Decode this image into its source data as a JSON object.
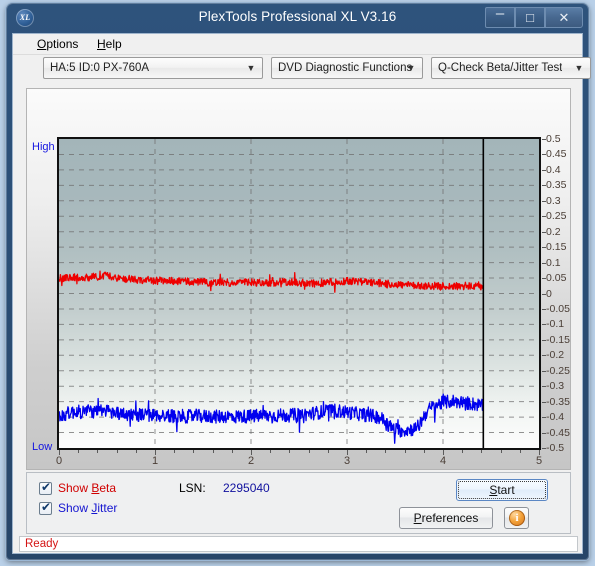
{
  "window": {
    "title": "PlexTools Professional XL V3.16",
    "icon": "xl-logo-icon",
    "minimize": "–",
    "maximize": "□",
    "close": "✕"
  },
  "menubar": {
    "items": [
      {
        "label": "Options",
        "accel": "O"
      },
      {
        "label": "Help",
        "accel": "H"
      }
    ]
  },
  "toolbar": {
    "drive_combo": {
      "value": "HA:5 ID:0  PX-760A",
      "arrow": "▼"
    },
    "function_combo": {
      "value": "DVD Diagnostic Functions",
      "arrow": "▼"
    },
    "test_combo": {
      "value": "Q-Check Beta/Jitter Test",
      "arrow": "▼"
    }
  },
  "chart_labels": {
    "high": "High",
    "low": "Low"
  },
  "controls": {
    "show_beta": {
      "label": "Show Beta",
      "accel": "B",
      "checked": true,
      "color": "#d00000",
      "tick": "✔"
    },
    "show_jitter": {
      "label": "Show Jitter",
      "accel": "J",
      "checked": true,
      "color": "#1515d0",
      "tick": "✔"
    },
    "lsn_label": "LSN:",
    "lsn_value": "2295040",
    "start_button": {
      "label": "Start",
      "accel": "S"
    },
    "preferences_button": {
      "label": "Preferences",
      "accel": "P"
    },
    "info_button": {
      "label": "i"
    }
  },
  "statusbar": {
    "text": "Ready"
  },
  "colors": {
    "beta": "#ee0000",
    "jitter": "#0000ee",
    "titlebar": "#2b4f77",
    "plot_top": "#a3b5b9",
    "plot_bottom": "#fdfdfd",
    "status_text": "#d41414",
    "marker_line": "#000000"
  },
  "chart_data": {
    "type": "line",
    "title": "Q-Check Beta/Jitter Test",
    "xlabel": "",
    "ylabel": "",
    "xlim": [
      0,
      5
    ],
    "ylim": [
      -0.5,
      0.5
    ],
    "grid": true,
    "legend_position": "bottom-left",
    "x_ticks": [
      0,
      1,
      2,
      3,
      4,
      5
    ],
    "y_ticks": [
      0.5,
      0.45,
      0.4,
      0.35,
      0.3,
      0.25,
      0.2,
      0.15,
      0.1,
      0.05,
      0,
      -0.05,
      -0.1,
      -0.15,
      -0.2,
      -0.25,
      -0.3,
      -0.35,
      -0.4,
      -0.45,
      -0.5
    ],
    "annotations": [
      {
        "type": "vline",
        "x": 4.42,
        "label": "data-end-marker"
      },
      {
        "type": "axis-text",
        "text": "High",
        "position": "top-left"
      },
      {
        "type": "axis-text",
        "text": "Low",
        "position": "bottom-left"
      }
    ],
    "series": [
      {
        "name": "Beta",
        "color": "#ee0000",
        "x_range": [
          0.0,
          4.42
        ],
        "noise_amplitude": 0.012,
        "values": [
          0.052,
          0.05,
          0.053,
          0.049,
          0.054,
          0.051,
          0.05,
          0.052,
          0.055,
          0.053,
          0.056,
          0.058,
          0.054,
          0.052,
          0.05,
          0.048,
          0.047,
          0.046,
          0.045,
          0.044,
          0.043,
          0.044,
          0.042,
          0.041,
          0.042,
          0.04,
          0.041,
          0.039,
          0.04,
          0.038,
          0.039,
          0.037,
          0.038,
          0.036,
          0.037,
          0.035,
          0.036,
          0.037,
          0.038,
          0.036,
          0.035,
          0.034,
          0.035,
          0.036,
          0.037,
          0.036,
          0.035,
          0.034,
          0.033,
          0.034,
          0.035,
          0.036,
          0.037,
          0.038,
          0.037,
          0.036,
          0.035,
          0.034,
          0.033,
          0.032,
          0.033,
          0.034,
          0.035,
          0.036,
          0.038,
          0.039,
          0.04,
          0.041,
          0.04,
          0.039,
          0.038,
          0.037,
          0.036,
          0.035,
          0.034,
          0.033,
          0.032,
          0.031,
          0.03,
          0.029,
          0.028,
          0.027,
          0.026,
          0.025,
          0.026,
          0.025,
          0.024,
          0.025,
          0.024,
          0.023,
          0.024,
          0.023,
          0.024,
          0.023,
          0.022,
          0.023,
          0.022,
          0.023,
          0.022,
          0.021
        ]
      },
      {
        "name": "Jitter",
        "color": "#0000ee",
        "x_range": [
          0.0,
          4.42
        ],
        "noise_amplitude": 0.022,
        "values": [
          -0.395,
          -0.392,
          -0.388,
          -0.385,
          -0.382,
          -0.384,
          -0.38,
          -0.378,
          -0.382,
          -0.385,
          -0.38,
          -0.378,
          -0.383,
          -0.386,
          -0.388,
          -0.39,
          -0.392,
          -0.39,
          -0.393,
          -0.392,
          -0.394,
          -0.393,
          -0.395,
          -0.394,
          -0.396,
          -0.395,
          -0.396,
          -0.397,
          -0.396,
          -0.397,
          -0.398,
          -0.397,
          -0.396,
          -0.397,
          -0.398,
          -0.397,
          -0.398,
          -0.399,
          -0.398,
          -0.397,
          -0.398,
          -0.399,
          -0.398,
          -0.397,
          -0.398,
          -0.397,
          -0.396,
          -0.397,
          -0.396,
          -0.395,
          -0.396,
          -0.395,
          -0.394,
          -0.395,
          -0.394,
          -0.393,
          -0.392,
          -0.391,
          -0.39,
          -0.388,
          -0.386,
          -0.384,
          -0.382,
          -0.38,
          -0.378,
          -0.38,
          -0.382,
          -0.384,
          -0.386,
          -0.388,
          -0.39,
          -0.392,
          -0.394,
          -0.396,
          -0.398,
          -0.402,
          -0.412,
          -0.428,
          -0.438,
          -0.442,
          -0.444,
          -0.442,
          -0.44,
          -0.438,
          -0.428,
          -0.4,
          -0.38,
          -0.368,
          -0.36,
          -0.356,
          -0.352,
          -0.35,
          -0.348,
          -0.35,
          -0.352,
          -0.354,
          -0.356,
          -0.358,
          -0.36,
          -0.362
        ]
      }
    ]
  }
}
